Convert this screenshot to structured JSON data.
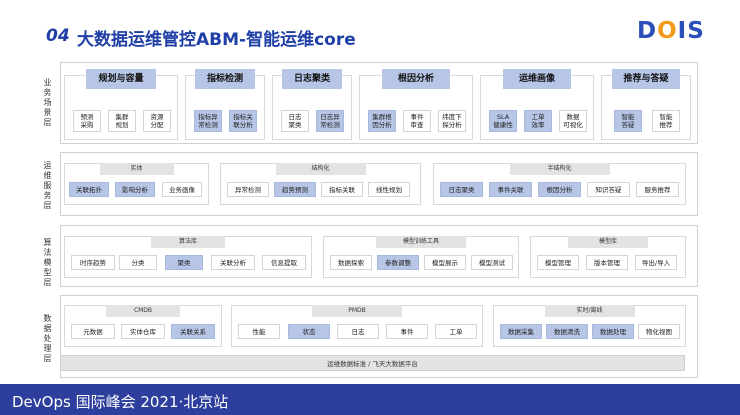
{
  "header": {
    "num": "04",
    "title": "大数据运维管控ABM-智能运维core"
  },
  "logo": {
    "text": "DOIS",
    "brand_color": "#2b4fb8",
    "accent_color": "#f29b1a"
  },
  "layers": {
    "business": {
      "label": "业务场景层",
      "groups": [
        {
          "title": "规划与容量",
          "items": [
            "预测\n采购",
            "集群\n规划",
            "资源\n分配"
          ]
        },
        {
          "title": "指标检测",
          "items": [
            "指标异\n常检测",
            "指标关\n联分析"
          ]
        },
        {
          "title": "日志聚类",
          "items": [
            "日志\n聚类",
            "日志异\n常检测"
          ]
        },
        {
          "title": "根因分析",
          "items": [
            "集群根\n因分析",
            "事件\n审查",
            "纬度下\n探分析"
          ]
        },
        {
          "title": "运维画像",
          "items": [
            "SLA\n健康性",
            "工单\n效率",
            "数据\n可视化"
          ]
        },
        {
          "title": "推荐与答疑",
          "items": [
            "智能\n答疑",
            "智能\n推荐"
          ]
        }
      ]
    },
    "service": {
      "label": "运维服务层",
      "groups": [
        {
          "title": "实体",
          "items": [
            "关联拓扑",
            "影响分析",
            "业务画像"
          ]
        },
        {
          "title": "结构化",
          "items": [
            "异常检测",
            "趋势预测",
            "指标关联",
            "线性规划"
          ]
        },
        {
          "title": "半结构化",
          "items": [
            "日志聚类",
            "事件关联",
            "根因分析",
            "知识答疑",
            "服务推荐"
          ]
        }
      ]
    },
    "algorithm": {
      "label": "算法模型层",
      "groups": [
        {
          "title": "算法库",
          "items": [
            "时序趋势",
            "分类",
            "聚类",
            "关联分析",
            "信息提取"
          ]
        },
        {
          "title": "模型训练工具",
          "items": [
            "数据探索",
            "参数调整",
            "模型展示",
            "模型测试"
          ]
        },
        {
          "title": "模型库",
          "items": [
            "模型管理",
            "版本管理",
            "导出/导入"
          ]
        }
      ]
    },
    "data": {
      "label": "数据处理层",
      "groups": [
        {
          "title": "CMDB",
          "items": [
            "元数据",
            "实体仓库",
            "关联关系"
          ]
        },
        {
          "title": "PMDB",
          "items": [
            "性能",
            "状态",
            "日志",
            "事件",
            "工单"
          ]
        },
        {
          "title": "实时/离线",
          "items": [
            "数据采集",
            "数据清洗",
            "数据处理",
            "物化视图"
          ]
        }
      ],
      "platform": "运维数据标准 / 飞天大数据平台"
    }
  },
  "footer": {
    "text": "DevOps 国际峰会 2021·北京站",
    "color": "#2d3e9c"
  }
}
